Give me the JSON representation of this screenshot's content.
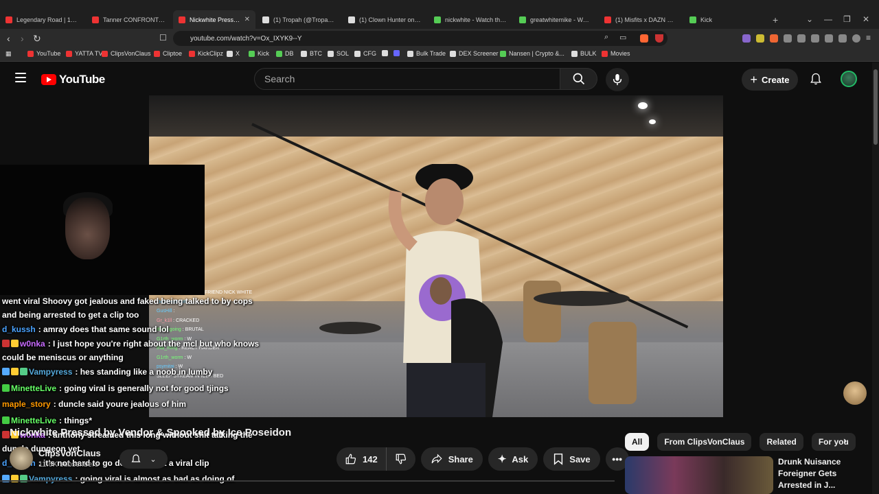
{
  "browser": {
    "tabs": [
      {
        "label": "Legendary Road | 100 km",
        "color": "#e33"
      },
      {
        "label": "Tanner CONFRONTS Nam",
        "color": "#e33"
      },
      {
        "label": "Nickwhite Pressed by",
        "color": "#e33",
        "active": true
      },
      {
        "label": "(1) Tropah (@TropahPalm",
        "color": "#ddd"
      },
      {
        "label": "(1) Clown Hunter on X: \"",
        "color": "#ddd"
      },
      {
        "label": "nickwhite - Watch the VO",
        "color": "#5c5"
      },
      {
        "label": "greatwhitemike - Watch t",
        "color": "#5c5"
      },
      {
        "label": "(1) Misfits x DAZN X 003:",
        "color": "#e33"
      },
      {
        "label": "Kick",
        "color": "#5c5"
      }
    ],
    "url": "youtube.com/watch?v=Ox_IXYK9--Y",
    "bookmarks": [
      {
        "label": "YouTube",
        "color": "#e33"
      },
      {
        "label": "YATTA TV",
        "color": "#e33"
      },
      {
        "label": "ClipsVonClaus",
        "color": "#e33"
      },
      {
        "label": "Cliptoe",
        "color": "#e33"
      },
      {
        "label": "KickClipz",
        "color": "#e33"
      },
      {
        "label": "X",
        "color": "#ddd"
      },
      {
        "label": "Kick",
        "color": "#5c5"
      },
      {
        "label": "DB",
        "color": "#5c5"
      },
      {
        "label": "BTC",
        "color": "#ddd"
      },
      {
        "label": "SOL",
        "color": "#ddd"
      },
      {
        "label": "CFG",
        "color": "#ddd"
      },
      {
        "label": "",
        "color": "#ddd"
      },
      {
        "label": "",
        "color": "#66f"
      },
      {
        "label": "Bulk Trade",
        "color": "#ddd"
      },
      {
        "label": "DEX Screener",
        "color": "#ddd"
      },
      {
        "label": "Nansen | Crypto &...",
        "color": "#5c5"
      },
      {
        "label": "BULK",
        "color": "#ddd"
      },
      {
        "label": "Movies",
        "color": "#e33"
      }
    ]
  },
  "youtube": {
    "logo_text": "YouTube",
    "search_placeholder": "Search",
    "create_label": "Create"
  },
  "stream_overlay": {
    "header": "FRIEND NICK WHITE",
    "lines": [
      {
        "user": "OnSkeetFohh",
        "text": ""
      },
      {
        "user": "GusHill",
        "text": ""
      },
      {
        "user": "Gr_k1ll",
        "text": "CRACKED"
      },
      {
        "user": "itkeepgoing",
        "text": "BRUTAL"
      },
      {
        "user": "G1rth_worm",
        "text": "W"
      },
      {
        "user": "thai_ming",
        "text": "REACT HARDER"
      },
      {
        "user": "G1rth_worm",
        "text": "W"
      },
      {
        "user": "psymitai",
        "text": "W"
      },
      {
        "user": "",
        "text": "SLEEP STREAM IN ICES BED"
      }
    ]
  },
  "chat": [
    {
      "user": "",
      "text": "went viral Shoovy got jealous and faked being talked to by cops and being arrested to get a clip too",
      "color": "#fff",
      "wrap": true
    },
    {
      "user": "d_kussh",
      "text": ": amray does that same sound lol",
      "color": "#4aa3ff"
    },
    {
      "user": "w0nka",
      "text": ": I just hope you're right about the mcl but who knows could be meniscus or anything",
      "color": "#c86bff",
      "wrap": true,
      "badges": [
        "#c33",
        "#fc3"
      ]
    },
    {
      "user": "Vampyress",
      "text": ": hes standing like a noob in lumby",
      "color": "#5ad",
      "badges": [
        "#5af",
        "#fc3",
        "#5c8"
      ]
    },
    {
      "user": "MinetteLive",
      "text": ": going viral is generally not for good tjings",
      "color": "#6f6",
      "badges": [
        "#4c4"
      ]
    },
    {
      "user": "maple_story",
      "text": ": duncle said youre jealous of him",
      "color": "#f90"
    },
    {
      "user": "MinetteLive",
      "text": ": things*",
      "color": "#6f6",
      "badges": [
        "#4c4"
      ]
    },
    {
      "user": "w0nka",
      "text": ": anthony streamed this long without shit talking the duncle dungeon yet",
      "color": "#c86bff",
      "wrap": true,
      "badges": [
        "#c33",
        "#fc3"
      ]
    },
    {
      "user": "d_kussh",
      "text": ": it's not hard to go do irl and get a viral clip",
      "color": "#4aa3ff"
    },
    {
      "user": "Vampyress",
      "text": ": going viral is almost as bad as doing of",
      "color": "#5ad",
      "badges": [
        "#5af",
        "#fc3",
        "#5c8"
      ]
    }
  ],
  "video": {
    "title": "Nickwhite Pressed by Vendor & Spooked by Ice Poseidon",
    "channel": "ClipsVonClaus",
    "subscribers": "11.6K subscribers",
    "likes": "142",
    "share_label": "Share",
    "ask_label": "Ask",
    "save_label": "Save"
  },
  "sidebar": {
    "chips": [
      "All",
      "From ClipsVonClaus",
      "Related",
      "For you"
    ],
    "recommendation_title": "Drunk Nuisance Foreigner Gets Arrested in J..."
  }
}
